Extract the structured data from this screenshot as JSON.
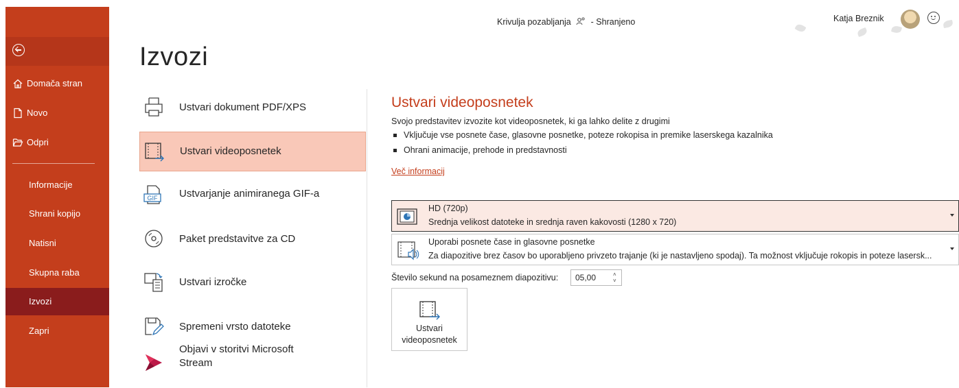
{
  "topbar": {
    "doc_title": "Krivulja pozabljanja",
    "save_status": "- Shranjeno",
    "user_name": "Katja Breznik"
  },
  "sidebar": {
    "items": [
      {
        "label": "Domača stran",
        "icon": "home-icon"
      },
      {
        "label": "Novo",
        "icon": "new-document-icon"
      },
      {
        "label": "Odpri",
        "icon": "folder-open-icon"
      },
      {
        "label": "Informacije"
      },
      {
        "label": "Shrani kopijo"
      },
      {
        "label": "Natisni"
      },
      {
        "label": "Skupna raba"
      },
      {
        "label": "Izvozi",
        "active": true
      },
      {
        "label": "Zapri"
      }
    ]
  },
  "page": {
    "title": "Izvozi"
  },
  "export_options": [
    {
      "label": "Ustvari dokument PDF/XPS",
      "icon": "pdf-document-icon"
    },
    {
      "label": "Ustvari videoposnetek",
      "icon": "video-icon",
      "selected": true
    },
    {
      "label": "Ustvarjanje animiranega GIF-a",
      "icon": "gif-icon",
      "icon_text": "GIF"
    },
    {
      "label": "Paket predstavitve za CD",
      "icon": "cd-icon"
    },
    {
      "label": "Ustvari izročke",
      "icon": "handouts-icon"
    },
    {
      "label": "Spremeni vrsto datoteke",
      "icon": "change-file-type-icon"
    },
    {
      "label_line1": "Objavi v storitvi Microsoft",
      "label_line2": "Stream",
      "icon": "microsoft-stream-icon"
    }
  ],
  "detail": {
    "title": "Ustvari videoposnetek",
    "description": "Svojo predstavitev izvozite kot videoposnetek, ki ga lahko delite z drugimi",
    "bullets": [
      "Vključuje vse posnete čase, glasovne posnetke, poteze rokopisa in premike laserskega kazalnika",
      "Ohrani animacije, prehode in predstavnosti"
    ],
    "more_info": "Več informacij",
    "quality_dropdown": {
      "title": "HD (720p)",
      "subtitle": "Srednja velikost datoteke in srednja raven kakovosti (1280 x 720)"
    },
    "timings_dropdown": {
      "title": "Uporabi posnete čase in glasovne posnetke",
      "subtitle": "Za diapozitive brez časov bo uporabljeno privzeto trajanje (ki je nastavljeno spodaj). Ta možnost vključuje rokopis in poteze lasersk..."
    },
    "seconds_label": "Število sekund na posameznem diapozitivu:",
    "seconds_value": "05,00",
    "create_button": {
      "line1": "Ustvari",
      "line2": "videoposnetek"
    }
  },
  "colors": {
    "accent": "#c43e1c",
    "sidebar_active": "#8a1c1c",
    "selected_option": "#f9c8b8"
  }
}
